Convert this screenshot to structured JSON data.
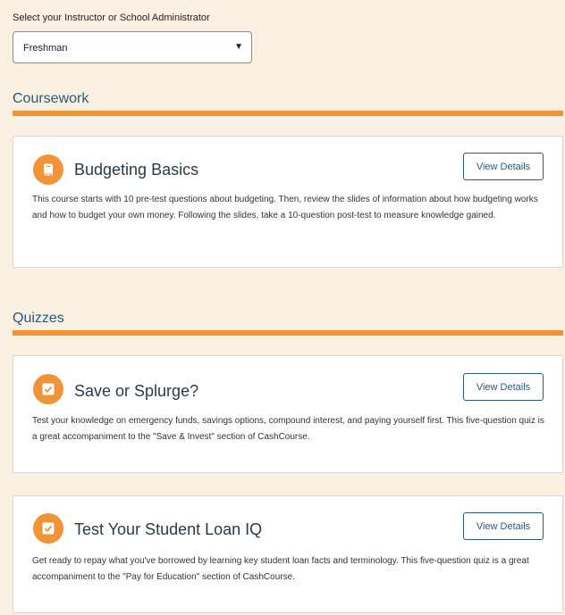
{
  "selector": {
    "label": "Select your Instructor or School Administrator",
    "value": "Freshman",
    "arrow": "▼"
  },
  "sections": {
    "coursework": {
      "title": "Coursework",
      "cards": [
        {
          "icon": "book-icon",
          "title": "Budgeting Basics",
          "button": "View Details",
          "description": "This course starts with 10 pre-test questions about budgeting. Then, review the slides of information about how budgeting works and how to budget your own money. Following the slides, take a 10-question post-test to measure knowledge gained."
        }
      ]
    },
    "quizzes": {
      "title": "Quizzes",
      "cards": [
        {
          "icon": "checkbox-icon",
          "title": "Save or Splurge?",
          "button": "View Details",
          "description": "Test your knowledge on emergency funds, savings options, compound interest, and paying yourself first. This five-question quiz is a great accompaniment to the \"Save & Invest\" section of CashCourse."
        },
        {
          "icon": "checkbox-icon",
          "title": "Test Your Student Loan IQ",
          "button": "View Details",
          "description": "Get ready to repay what you've borrowed by learning key student loan facts and terminology. This five-question quiz is a great accompaniment to the \"Pay for Education\" section of CashCourse."
        }
      ]
    }
  },
  "colors": {
    "accent": "#f19438",
    "heading": "#2a5a79",
    "background": "#f9f0e2"
  }
}
